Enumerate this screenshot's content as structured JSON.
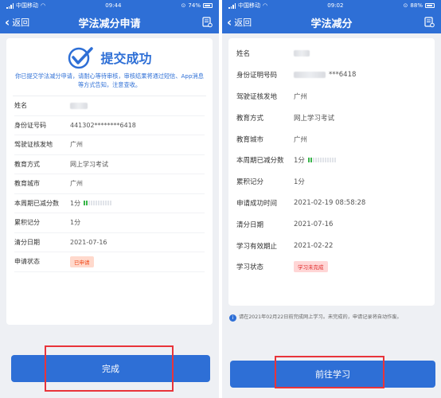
{
  "left": {
    "status": {
      "carrier": "中国移动",
      "time": "09:44",
      "battery": "74%"
    },
    "nav": {
      "back_label": "返回",
      "title": "学法减分申请"
    },
    "success_title": "提交成功",
    "notice": "你已提交学法减分申请，请耐心等待审核，审核结果将通过短信、App消息等方式告知，注意查收。",
    "rows": [
      {
        "label": "姓名",
        "value": ""
      },
      {
        "label": "身份证号码",
        "value": "441302********6418"
      },
      {
        "label": "驾驶证核发地",
        "value": "广州"
      },
      {
        "label": "教育方式",
        "value": "网上学习考试"
      },
      {
        "label": "教育城市",
        "value": "广州"
      },
      {
        "label": "本周期已减分数",
        "value": "1分"
      },
      {
        "label": "累积记分",
        "value": "1分"
      },
      {
        "label": "清分日期",
        "value": "2021-07-16"
      },
      {
        "label": "申请状态",
        "value": "已申请"
      }
    ],
    "button": "完成"
  },
  "right": {
    "status": {
      "carrier": "中国移动",
      "time": "09:02",
      "battery": "88%"
    },
    "nav": {
      "back_label": "返回",
      "title": "学法减分"
    },
    "rows": [
      {
        "label": "姓名",
        "value": ""
      },
      {
        "label": "身份证明号码",
        "value": "***6418"
      },
      {
        "label": "驾驶证核发地",
        "value": "广州"
      },
      {
        "label": "教育方式",
        "value": "网上学习考试"
      },
      {
        "label": "教育城市",
        "value": "广州"
      },
      {
        "label": "本周期已减分数",
        "value": "1分"
      },
      {
        "label": "累积记分",
        "value": "1分"
      },
      {
        "label": "申请成功时间",
        "value": "2021-02-19 08:58:28"
      },
      {
        "label": "清分日期",
        "value": "2021-07-16"
      },
      {
        "label": "学习有效期止",
        "value": "2021-02-22"
      },
      {
        "label": "学习状态",
        "value": "学习未完成"
      }
    ],
    "hint": "请在2021年02月22日前完成网上学习。未完成的，申请记录将自动作废。",
    "button": "前往学习"
  },
  "colors": {
    "primary": "#2e6fd6",
    "highlight_box": "#e8343a",
    "progress": "#39b54a"
  }
}
